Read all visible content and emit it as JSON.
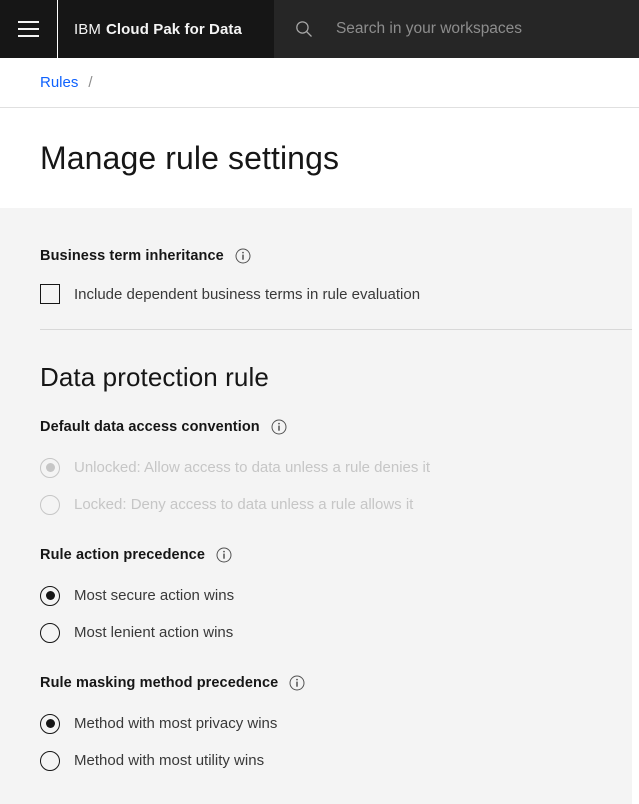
{
  "header": {
    "menu_icon": "hamburger-menu-icon",
    "brand_prefix": "IBM",
    "brand_name": "Cloud Pak for Data",
    "search_icon": "search-icon",
    "search_placeholder": "Search in your workspaces",
    "search_value": "",
    "bg_color": "#161616",
    "search_bg_color": "#262626"
  },
  "breadcrumb": {
    "link_label": "Rules",
    "separator": "/",
    "link_color": "#0f62fe"
  },
  "page": {
    "title": "Manage rule settings"
  },
  "business_term_inheritance": {
    "label": "Business term inheritance",
    "info_icon": "info-icon",
    "checkbox": {
      "label": "Include dependent business terms in rule evaluation",
      "checked": false
    }
  },
  "data_protection_rule": {
    "title": "Data protection rule",
    "default_data_access_convention": {
      "label": "Default data access convention",
      "info_icon": "info-icon",
      "disabled": true,
      "options": [
        {
          "label": "Unlocked: Allow access to data unless a rule denies it",
          "selected": true
        },
        {
          "label": "Locked: Deny access to data unless a rule allows it",
          "selected": false
        }
      ]
    },
    "rule_action_precedence": {
      "label": "Rule action precedence",
      "info_icon": "info-icon",
      "disabled": false,
      "options": [
        {
          "label": "Most secure action wins",
          "selected": true
        },
        {
          "label": "Most lenient action wins",
          "selected": false
        }
      ]
    },
    "rule_masking_method_precedence": {
      "label": "Rule masking method precedence",
      "info_icon": "info-icon",
      "disabled": false,
      "options": [
        {
          "label": "Method with most privacy wins",
          "selected": true
        },
        {
          "label": "Method with most utility wins",
          "selected": false
        }
      ]
    }
  },
  "theme": {
    "content_bg": "#f4f4f4",
    "white_bg": "#ffffff",
    "text_primary": "#161616",
    "text_secondary": "#393939",
    "disabled": "#c6c6c6",
    "divider": "#d8d8d8"
  }
}
